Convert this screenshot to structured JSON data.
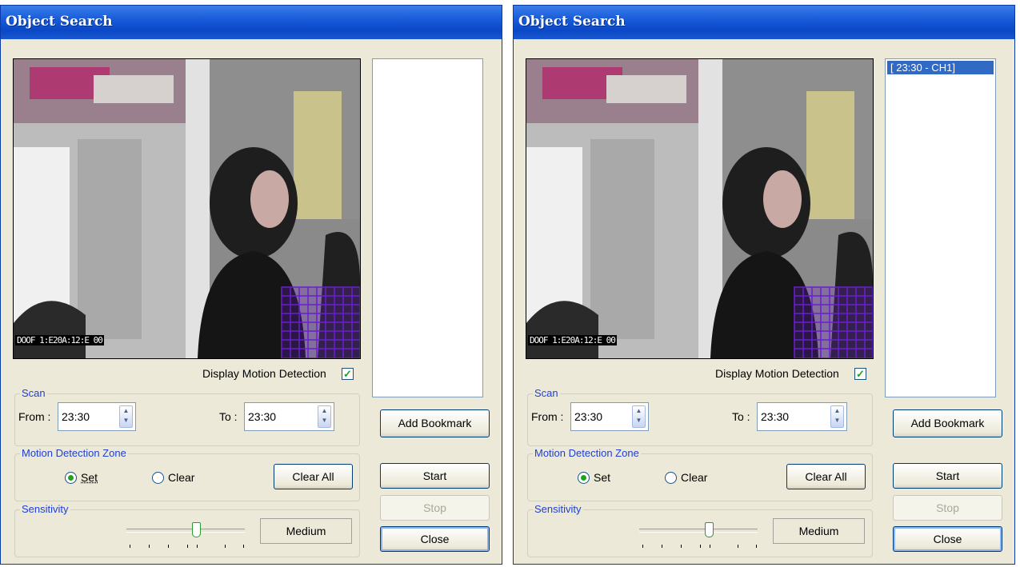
{
  "windows": [
    {
      "title": "Object Search",
      "video_timestamp": "DOOF 1:E20A:12:E 00",
      "bookmarks": [],
      "display_motion_label": "Display Motion Detection",
      "display_motion_checked": true,
      "scan": {
        "legend": "Scan",
        "from_label": "From :",
        "from_value": "23:30",
        "to_label": "To :",
        "to_value": "23:30"
      },
      "zone": {
        "legend": "Motion Detection Zone",
        "set_label": "Set",
        "clear_label": "Clear",
        "clear_all_label": "Clear All",
        "selected": "set"
      },
      "sensitivity": {
        "legend": "Sensitivity",
        "value_label": "Medium",
        "level": 0.625
      },
      "buttons": {
        "add_bookmark": "Add Bookmark",
        "start": "Start",
        "stop": "Stop",
        "close": "Close"
      }
    },
    {
      "title": "Object Search",
      "video_timestamp": "DOOF 1:E20A:12:E 00",
      "bookmarks": [
        "[ 23:30 - CH1]"
      ],
      "display_motion_label": "Display Motion Detection",
      "display_motion_checked": true,
      "scan": {
        "legend": "Scan",
        "from_label": "From :",
        "from_value": "23:30",
        "to_label": "To :",
        "to_value": "23:30"
      },
      "zone": {
        "legend": "Motion Detection Zone",
        "set_label": "Set",
        "clear_label": "Clear",
        "clear_all_label": "Clear All",
        "selected": "set"
      },
      "sensitivity": {
        "legend": "Sensitivity",
        "value_label": "Medium",
        "level": 0.625
      },
      "buttons": {
        "add_bookmark": "Add Bookmark",
        "start": "Start",
        "stop": "Stop",
        "close": "Close"
      }
    }
  ],
  "colors": {
    "titlebar": "#0a48c6",
    "legend_text": "#1f3fd3",
    "dialog_bg": "#ece9d8",
    "selection": "#316ac5",
    "motion_grid": "#6a1fd0",
    "check_green": "#21a121"
  }
}
